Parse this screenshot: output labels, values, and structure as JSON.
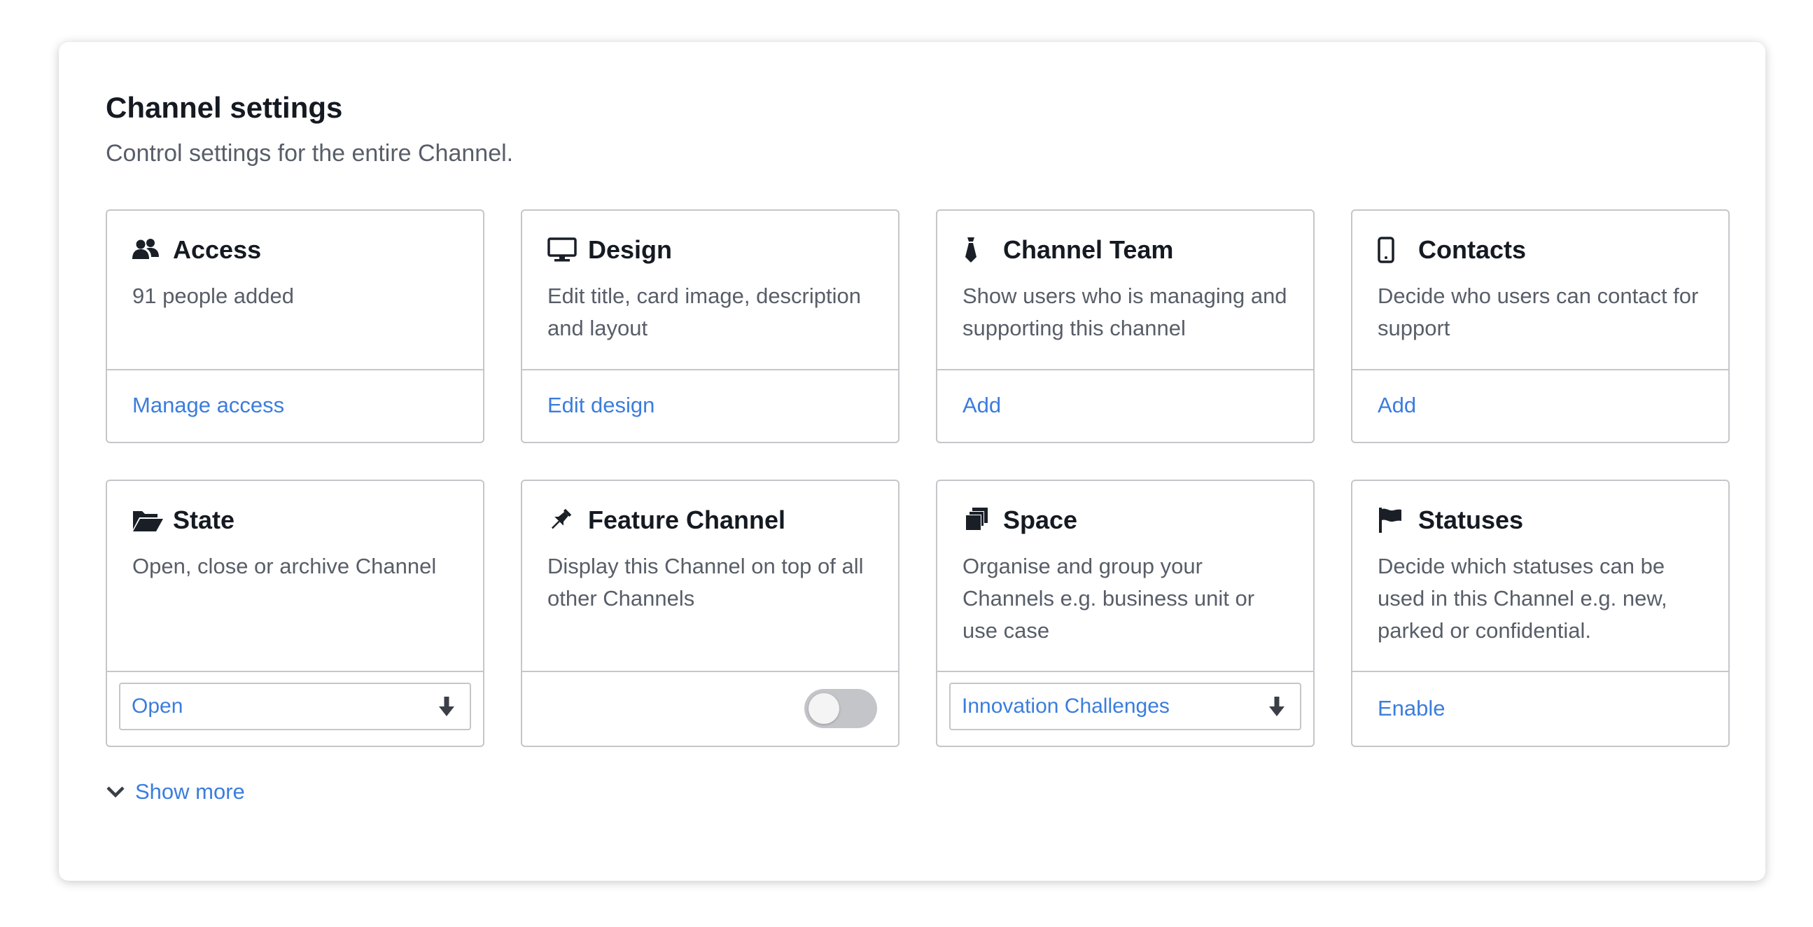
{
  "panel": {
    "title": "Channel settings",
    "subtitle": "Control settings for the entire Channel."
  },
  "cards": {
    "access": {
      "icon": "users-icon",
      "title": "Access",
      "description": "91 people added",
      "link": "Manage access"
    },
    "design": {
      "icon": "monitor-icon",
      "title": "Design",
      "description": "Edit title, card image, description and layout",
      "link": "Edit design"
    },
    "team": {
      "icon": "tie-icon",
      "title": "Channel Team",
      "description": "Show users who is managing and supporting this channel",
      "link": "Add"
    },
    "contacts": {
      "icon": "mobile-phone-icon",
      "title": "Contacts",
      "description": "Decide who users can contact for support",
      "link": "Add"
    },
    "state": {
      "icon": "folder-open-icon",
      "title": "State",
      "description": "Open, close or archive Channel",
      "select_value": "Open"
    },
    "feature": {
      "icon": "pin-icon",
      "title": "Feature Channel",
      "description": "Display this Channel on top of all other Channels",
      "toggle_on": false
    },
    "space": {
      "icon": "stacked-copies-icon",
      "title": "Space",
      "description": "Organise and group your Channels e.g. business unit or use case",
      "select_value": "Innovation Challenges"
    },
    "statuses": {
      "icon": "flag-icon",
      "title": "Statuses",
      "description": "Decide which statuses can be used in this Channel e.g. new, parked or confidential.",
      "link": "Enable"
    }
  },
  "footer": {
    "show_more": "Show more"
  },
  "colors": {
    "link": "#3b7ddd",
    "title": "#151a22",
    "muted": "#585e68",
    "border": "#c4c6ca"
  }
}
